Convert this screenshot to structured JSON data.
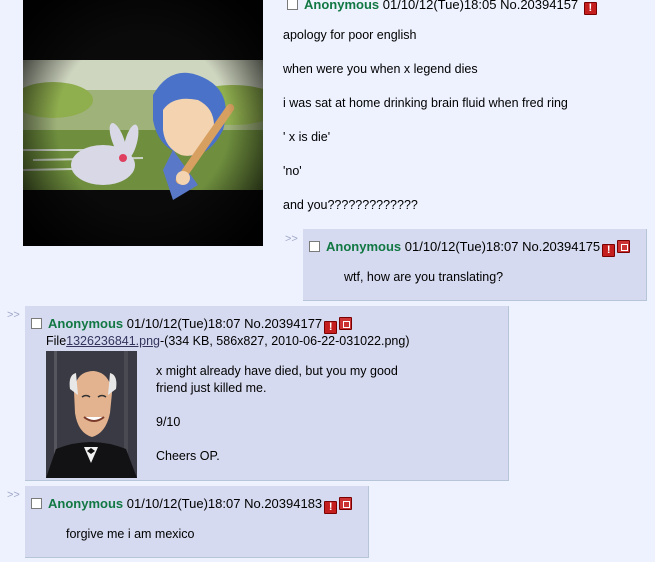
{
  "op": {
    "name": "Anonymous",
    "datetime": "01/10/12(Tue)18:05",
    "number": "No.20394157",
    "lines": [
      "apology for poor english",
      "when were you when x legend dies",
      "i was sat at home drinking brain fluid when fred ring",
      "' x is die'",
      "'no'",
      "and you?????????????"
    ]
  },
  "replies": [
    {
      "name": "Anonymous",
      "datetime": "01/10/12(Tue)18:07",
      "number": "No.20394175",
      "message": "wtf, how are you translating?"
    },
    {
      "name": "Anonymous",
      "datetime": "01/10/12(Tue)18:07",
      "number": "No.20394177",
      "file_prefix": "File",
      "file_name": "1326236841.png",
      "file_info": "-(334 KB, 586x827, 2010-06-22-031022.png)",
      "lines": [
        "x might already have died, but you my good friend just killed me.",
        "9/10",
        "Cheers OP."
      ]
    },
    {
      "name": "Anonymous",
      "datetime": "01/10/12(Tue)18:07",
      "number": "No.20394183",
      "message": "forgive me i am mexico"
    }
  ],
  "ui": {
    "reply_arrow": ">>",
    "report_glyph": "!"
  },
  "colors": {
    "background": "#eef2ff",
    "reply_background": "#d6daf0",
    "name": "#117743",
    "report": "#c41e1e"
  }
}
